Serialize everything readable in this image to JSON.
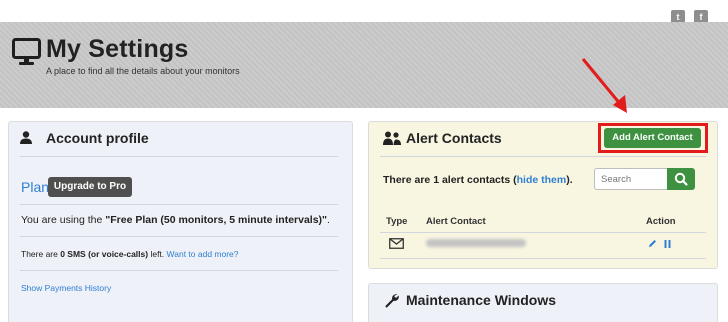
{
  "social": {
    "twitter_glyph": "t",
    "facebook_glyph": "f"
  },
  "header": {
    "title": "My Settings",
    "subtitle": "A place to find all the details about your monitors",
    "icon": "monitor-icon"
  },
  "account_profile": {
    "title": "Account profile",
    "icon": "user-icon",
    "plan_label": "Plan",
    "upgrade_button": "Upgrade to Pro",
    "plan_prefix": "You are using the ",
    "plan_name": "\"Free Plan (50 monitors, 5 minute intervals)\"",
    "plan_suffix": ".",
    "sms_prefix": "There are ",
    "sms_count": "0 SMS (or voice-calls)",
    "sms_suffix": " left.",
    "sms_link": "Want to add more?",
    "payments_link": "Show Payments History"
  },
  "alert_contacts": {
    "title": "Alert Contacts",
    "icon": "contacts-icon",
    "add_button": "Add Alert Contact",
    "count_text": "There are 1 alert contacts (",
    "hide_link": "hide them",
    "count_suffix": ").",
    "search_placeholder": "Search",
    "columns": [
      "Type",
      "Alert Contact",
      "Action"
    ],
    "rows": [
      {
        "type_icon": "mail-icon",
        "contact": "",
        "actions": [
          "edit-icon",
          "pause-icon"
        ]
      }
    ]
  },
  "maintenance": {
    "title": "Maintenance Windows",
    "icon": "wrench-icon"
  },
  "colors": {
    "header_bg": "#c9c9c9",
    "link": "#2f7fd4",
    "green_button": "#3d9140",
    "dark_button": "#4f4f4f",
    "highlight": "#e21b1b",
    "alert_panel_bg": "#f8f6e1",
    "panel_bg": "#eef1f7"
  }
}
